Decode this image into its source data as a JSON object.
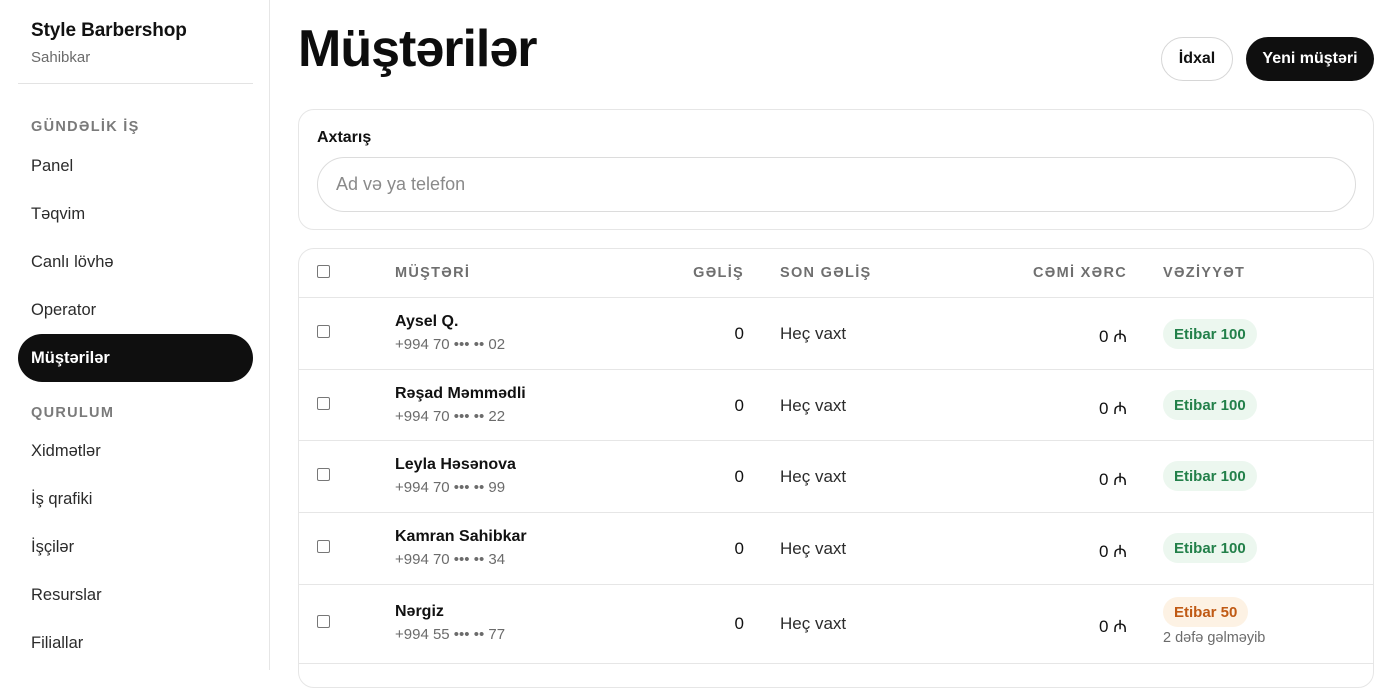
{
  "sidebar": {
    "brand_name": "Style Barbershop",
    "brand_role": "Sahibkar",
    "section_daily": "GÜNDƏLİK İŞ",
    "items_daily": [
      "Panel",
      "Təqvim",
      "Canlı lövhə",
      "Operator",
      "Müştərilər"
    ],
    "section_setup": "QURULUM",
    "items_setup": [
      "Xidmətlər",
      "İş qrafiki",
      "İşçilər",
      "Resurslar",
      "Filiallar"
    ],
    "active_item": "Müştərilər"
  },
  "header": {
    "title": "Müştərilər",
    "import_label": "İdxal",
    "new_label": "Yeni müştəri"
  },
  "search": {
    "label": "Axtarış",
    "placeholder": "Ad və ya telefon",
    "value": ""
  },
  "table": {
    "columns": {
      "customer": "MÜŞTƏRİ",
      "visits": "GƏLİŞ",
      "last_visit": "SON GƏLİŞ",
      "total_spent": "CƏMİ XƏRC",
      "status": "VƏZİYYƏT"
    },
    "rows": [
      {
        "name": "Aysel Q.",
        "phone": "+994 70 ••• •• 02",
        "visits": "0",
        "last_visit": "Heç vaxt",
        "spent": "0 ₼",
        "status": "Etibar 100",
        "status_color": "green",
        "note": ""
      },
      {
        "name": "Rəşad Məmmədli",
        "phone": "+994 70 ••• •• 22",
        "visits": "0",
        "last_visit": "Heç vaxt",
        "spent": "0 ₼",
        "status": "Etibar 100",
        "status_color": "green",
        "note": ""
      },
      {
        "name": "Leyla Həsənova",
        "phone": "+994 70 ••• •• 99",
        "visits": "0",
        "last_visit": "Heç vaxt",
        "spent": "0 ₼",
        "status": "Etibar 100",
        "status_color": "green",
        "note": ""
      },
      {
        "name": "Kamran Sahibkar",
        "phone": "+994 70 ••• •• 34",
        "visits": "0",
        "last_visit": "Heç vaxt",
        "spent": "0 ₼",
        "status": "Etibar 100",
        "status_color": "green",
        "note": ""
      },
      {
        "name": "Nərgiz",
        "phone": "+994 55 ••• •• 77",
        "visits": "0",
        "last_visit": "Heç vaxt",
        "spent": "0 ₼",
        "status": "Etibar 50",
        "status_color": "orange",
        "note": "2 dəfə gəlməyib"
      }
    ]
  },
  "colors": {
    "active_nav_bg": "#0f0f0f",
    "status_green_text": "#23804a",
    "status_green_bg": "#ecf7ef",
    "status_orange_text": "#c05a14",
    "status_orange_bg": "#fdf2e4"
  }
}
